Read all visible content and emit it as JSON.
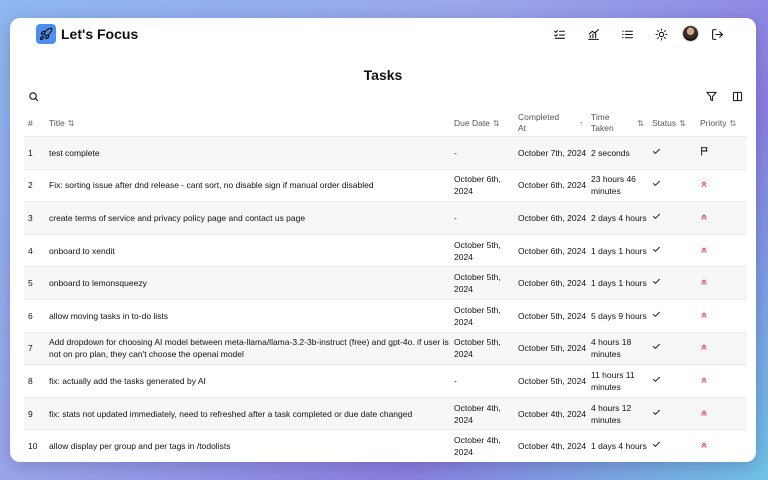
{
  "app": {
    "title": "Let's Focus"
  },
  "page": {
    "title": "Tasks"
  },
  "columns": [
    {
      "key": "num",
      "label": "#"
    },
    {
      "key": "title",
      "label": "Title",
      "sort": "⇅"
    },
    {
      "key": "due",
      "label": "Due Date",
      "sort": "⇅"
    },
    {
      "key": "completed",
      "label": "Completed At",
      "sort": "↑"
    },
    {
      "key": "taken",
      "label": "Time Taken",
      "sort": "⇅"
    },
    {
      "key": "status",
      "label": "Status",
      "sort": "⇅"
    },
    {
      "key": "priority",
      "label": "Priority",
      "sort": "⇅"
    }
  ],
  "rows": [
    {
      "num": "1",
      "title": "test complete",
      "due": "-",
      "completed": "October 7th, 2024",
      "taken": "2 seconds",
      "priority": "flag-icon"
    },
    {
      "num": "2",
      "title": "Fix: sorting issue after dnd release - cant sort, no disable sign if manual order disabled",
      "due": "October 6th, 2024",
      "completed": "October 6th, 2024",
      "taken": "23 hours 46 minutes",
      "priority": "double-chevron-up-icon"
    },
    {
      "num": "3",
      "title": "create terms of service and privacy policy page and contact us page",
      "due": "-",
      "completed": "October 6th, 2024",
      "taken": "2 days 4 hours",
      "priority": "double-chevron-up-icon"
    },
    {
      "num": "4",
      "title": "onboard to xendit",
      "due": "October 5th, 2024",
      "completed": "October 6th, 2024",
      "taken": "1 days 1 hours",
      "priority": "double-chevron-up-icon"
    },
    {
      "num": "5",
      "title": "onboard to lemonsqueezy",
      "due": "October 5th, 2024",
      "completed": "October 6th, 2024",
      "taken": "1 days 1 hours",
      "priority": "double-chevron-up-icon"
    },
    {
      "num": "6",
      "title": "allow moving tasks in to-do lists",
      "due": "October 5th, 2024",
      "completed": "October 5th, 2024",
      "taken": "5 days 9 hours",
      "priority": "double-chevron-up-icon"
    },
    {
      "num": "7",
      "title": "Add dropdown for choosing AI model between meta-llama/llama-3.2-3b-instruct (free) and gpt-4o. if user is not on pro plan, they can't choose the openai model",
      "due": "October 5th, 2024",
      "completed": "October 5th, 2024",
      "taken": "4 hours 18 minutes",
      "priority": "double-chevron-up-icon"
    },
    {
      "num": "8",
      "title": "fix: actually add the tasks generated by AI",
      "due": "-",
      "completed": "October 5th, 2024",
      "taken": "11 hours 11 minutes",
      "priority": "double-chevron-up-icon"
    },
    {
      "num": "9",
      "title": "fix: stats not updated immediately, need to refreshed after a task completed or due date changed",
      "due": "October 4th, 2024",
      "completed": "October 4th, 2024",
      "taken": "4 hours 12 minutes",
      "priority": "double-chevron-up-icon"
    },
    {
      "num": "10",
      "title": "allow display per group and per tags in /todolists",
      "due": "October 4th, 2024",
      "completed": "October 4th, 2024",
      "taken": "1 days 4 hours",
      "priority": "double-chevron-up-icon"
    }
  ],
  "colors": {
    "accent": "#4c8ff0",
    "priority_high": "#e53935"
  },
  "icons": {
    "logo": "rocket-icon",
    "nav": [
      "checklist-icon",
      "chart-icon",
      "list-icon",
      "sun-icon",
      "avatar",
      "logout-icon"
    ],
    "toolbar": [
      "search-icon",
      "filter-icon",
      "columns-icon"
    ],
    "status": "check-icon"
  }
}
